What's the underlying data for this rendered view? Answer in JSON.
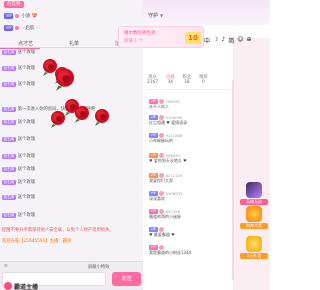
{
  "top": {
    "badge": "的音频"
  },
  "vip_rows": [
    {
      "label": "VIP",
      "text": "小骄 💝"
    },
    {
      "label": "VIP",
      "text": "☞启航 ☜"
    }
  ],
  "tabs": [
    "点才艺",
    "礼单",
    "活动"
  ],
  "host": {
    "name": "守护"
  },
  "vip_card": {
    "line1": "赠尔数玩神生效",
    "line2": "刚满 1 个",
    "number": "10"
  },
  "tools": [
    "中",
    "☽",
    "♪",
    "简",
    "☺",
    "⊕"
  ],
  "stat_tabs": [
    {
      "label": "观众",
      "count": "2167"
    },
    {
      "label": "贡献",
      "count": "34"
    },
    {
      "label": "粉丝",
      "count": "18"
    },
    {
      "label": "推荐",
      "count": "0"
    }
  ],
  "chat_messages": [
    {
      "tag": "钻石用",
      "text": "送个玫瑰"
    },
    {
      "tag": "钻石用",
      "text": "送个玫瑰"
    },
    {
      "tag": "钻石用",
      "text": "送个玫瑰"
    },
    {
      "tag": "钻石用",
      "text": "第一次进入你的房间，快和他打个招呼吧"
    },
    {
      "tag": "钻石用",
      "text": "送个玫瑰"
    },
    {
      "tag": "钻石用",
      "text": "送个玫瑰"
    },
    {
      "tag": "钻石用",
      "text": "送个玫瑰"
    },
    {
      "tag": "钻石用",
      "text": "送个玫瑰"
    },
    {
      "tag": "钻石用",
      "text": "送个玫瑰"
    },
    {
      "tag": "钻石用",
      "text": "送个玫瑰"
    },
    {
      "tag": "钻石用",
      "text": "送个玫瑰"
    }
  ],
  "system_note": "提醒不要分手需保持他人安全联，以免个人财产受到损失。",
  "system_note2": "欢迎光临【25645591】主播：霸道",
  "input": {
    "placeholder": "",
    "send": "发送",
    "tool1": "屏蔽小特效",
    "tool2": "⊙"
  },
  "banner": {
    "text": "霸道主播"
  },
  "fans": [
    {
      "badge": "VIP",
      "id": "796591",
      "desc": "永不人的人"
    },
    {
      "badge": "VIP",
      "id": "5130000",
      "desc": "红尘相遇 ♥ 爱情语录"
    },
    {
      "badge": "VIP",
      "id": "9111808",
      "desc": "小布偷偷玩的"
    },
    {
      "badge": "VIP",
      "id": "508052",
      "desc": "♥ 爱你到天长地久 ♥"
    },
    {
      "badge": "VIP",
      "id": "8211135",
      "desc": "我爱你们大家"
    },
    {
      "badge": "VIP",
      "id": "5306531",
      "desc": "深深喜欢"
    },
    {
      "badge": "VIP",
      "id": "657458",
      "desc": "霸道帅哥的小迷妹"
    },
    {
      "badge": "VIP",
      "id": "",
      "desc": "♥ 最爱霸道 ♥"
    },
    {
      "badge": "VIP",
      "id": "",
      "desc": "我是霸道的小粉丝1344"
    }
  ],
  "side": [
    {
      "label": "英雄无双"
    },
    {
      "label": "财神大奖"
    },
    {
      "label": "1元礼包"
    }
  ],
  "colors": {
    "accent": "#ff6aa1",
    "rose": "#d51426",
    "vip": "#6a63ff"
  }
}
